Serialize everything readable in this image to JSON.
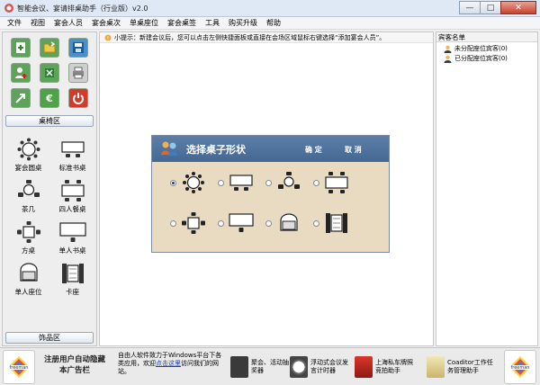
{
  "window": {
    "title": "智能会议、宴请排桌助手（行业版）v2.0",
    "controls": [
      "—",
      "□",
      "✕"
    ]
  },
  "menu": [
    "文件",
    "视图",
    "宴会人员",
    "宴会桌次",
    "单桌座位",
    "宴会桌签",
    "工具",
    "购买升级",
    "帮助"
  ],
  "tip": "小提示：新建会议后，您可以点击左侧快捷面板或直接在会场区域鼠标右键选择“添加宴会人员”。",
  "left": {
    "section_tables": "桌椅区",
    "tables": [
      {
        "label": "宴会圆桌",
        "icon": "round-table-icon"
      },
      {
        "label": "标准书桌",
        "icon": "desk-icon"
      },
      {
        "label": "茶几",
        "icon": "tea-table-icon"
      },
      {
        "label": "四人餐桌",
        "icon": "four-seat-table-icon"
      },
      {
        "label": "方桌",
        "icon": "square-table-icon"
      },
      {
        "label": "单人书桌",
        "icon": "single-desk-icon"
      },
      {
        "label": "单人座位",
        "icon": "single-seat-icon"
      },
      {
        "label": "卡座",
        "icon": "booth-icon"
      }
    ],
    "section_decor": "饰品区"
  },
  "dialog": {
    "title": "选择桌子形状",
    "ok": "确 定",
    "cancel": "取 消"
  },
  "right": {
    "header": "宾客名单",
    "items": [
      "未分配座位宾客(0)",
      "已分配座位宾客(0)"
    ]
  },
  "ad": {
    "brand": "freeman",
    "slogan_line1": "注册用户自动隐藏",
    "slogan_line2": "本广告栏",
    "desc_prefix": "自由人软件致力于Windows平台下各类应用，欢迎",
    "desc_link": "点击这里",
    "desc_suffix": "访问我们的网站。",
    "products": [
      "聚会、活动抽奖器",
      "浮动式会议发言计时器",
      "上海私车牌照竞拍助手",
      "Coaditor工作任务管理助手"
    ]
  },
  "colors": {
    "dialog_header": "#4f73a0",
    "dialog_body": "#e8dbc1",
    "link": "#1a3fbf"
  }
}
